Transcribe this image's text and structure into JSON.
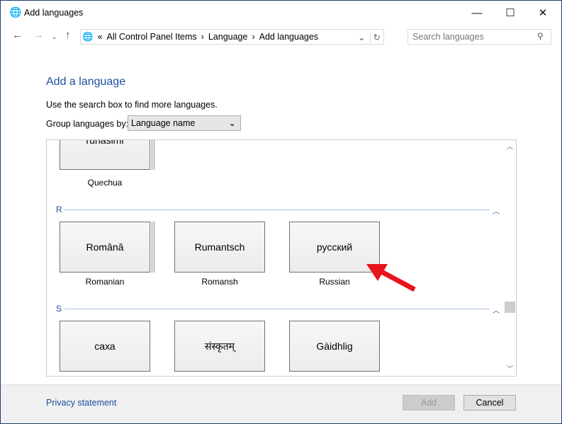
{
  "window": {
    "title": "Add languages",
    "minimize": "—",
    "maximize": "☐",
    "close": "✕"
  },
  "address": {
    "prefix": "«",
    "crumbs": [
      "All Control Panel Items",
      "Language",
      "Add languages"
    ],
    "sep": "›"
  },
  "search": {
    "placeholder": "Search languages"
  },
  "main": {
    "heading": "Add a language",
    "hint": "Use the search box to find more languages.",
    "group_label": "Group languages by:",
    "group_value": "Language name"
  },
  "sections": [
    {
      "letter": "",
      "tiles": [
        {
          "native": "runasimi",
          "name": "Quechua"
        }
      ]
    },
    {
      "letter": "R",
      "tiles": [
        {
          "native": "Română",
          "name": "Romanian"
        },
        {
          "native": "Rumantsch",
          "name": "Romansh"
        },
        {
          "native": "русский",
          "name": "Russian"
        }
      ]
    },
    {
      "letter": "S",
      "tiles": [
        {
          "native": "саха",
          "name": ""
        },
        {
          "native": "संस्कृतम्",
          "name": ""
        },
        {
          "native": "Gàidhlig",
          "name": ""
        }
      ]
    }
  ],
  "footer": {
    "privacy": "Privacy statement",
    "add": "Add",
    "cancel": "Cancel"
  },
  "colors": {
    "accent": "#1e4fa0",
    "annotation_arrow": "#e8141b"
  }
}
